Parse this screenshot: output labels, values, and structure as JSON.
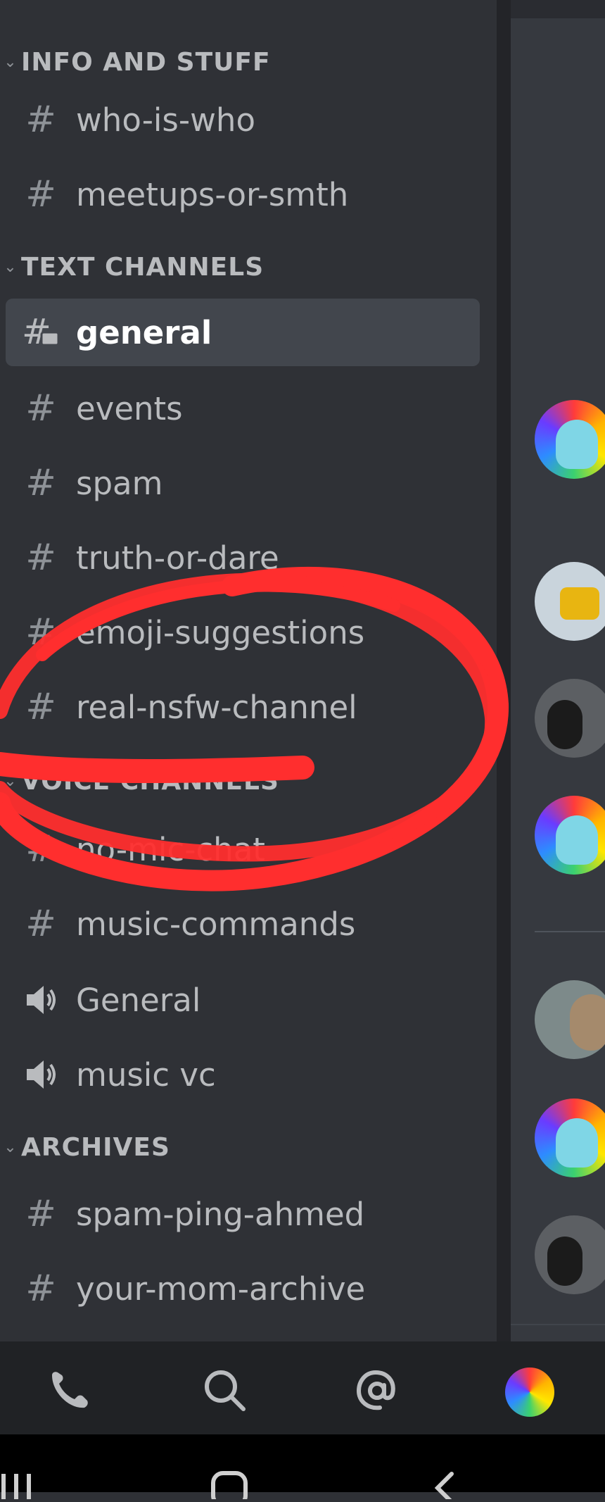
{
  "categories": [
    {
      "name": "INFO AND STUFF"
    },
    {
      "name": "TEXT CHANNELS"
    },
    {
      "name": "VOICE CHANNELS"
    },
    {
      "name": "ARCHIVES"
    }
  ],
  "channels": [
    {
      "label": "who-is-who",
      "icon": "hash-icon"
    },
    {
      "label": "meetups-or-smth",
      "icon": "hash-icon"
    },
    {
      "label": "general",
      "icon": "hash-thread-icon",
      "selected": true
    },
    {
      "label": "events",
      "icon": "hash-icon"
    },
    {
      "label": "spam",
      "icon": "hash-icon"
    },
    {
      "label": "truth-or-dare",
      "icon": "hash-icon"
    },
    {
      "label": "emoji-suggestions",
      "icon": "hash-icon"
    },
    {
      "label": "real-nsfw-channel",
      "icon": "hash-icon"
    },
    {
      "label": "no-mic-chat",
      "icon": "hash-icon"
    },
    {
      "label": "music-commands",
      "icon": "hash-icon"
    },
    {
      "label": "General",
      "icon": "speaker-icon"
    },
    {
      "label": "music vc",
      "icon": "speaker-icon"
    },
    {
      "label": "spam-ping-ahmed",
      "icon": "hash-icon"
    },
    {
      "label": "your-mom-archive",
      "icon": "hash-icon"
    }
  ],
  "bottom_nav": [
    "friends-icon",
    "search-icon",
    "mention-icon",
    "user-avatar"
  ],
  "colors": {
    "sidebar_bg": "#2f3136",
    "selected_bg": "#42464d",
    "annotation": "#ff2e2e"
  }
}
